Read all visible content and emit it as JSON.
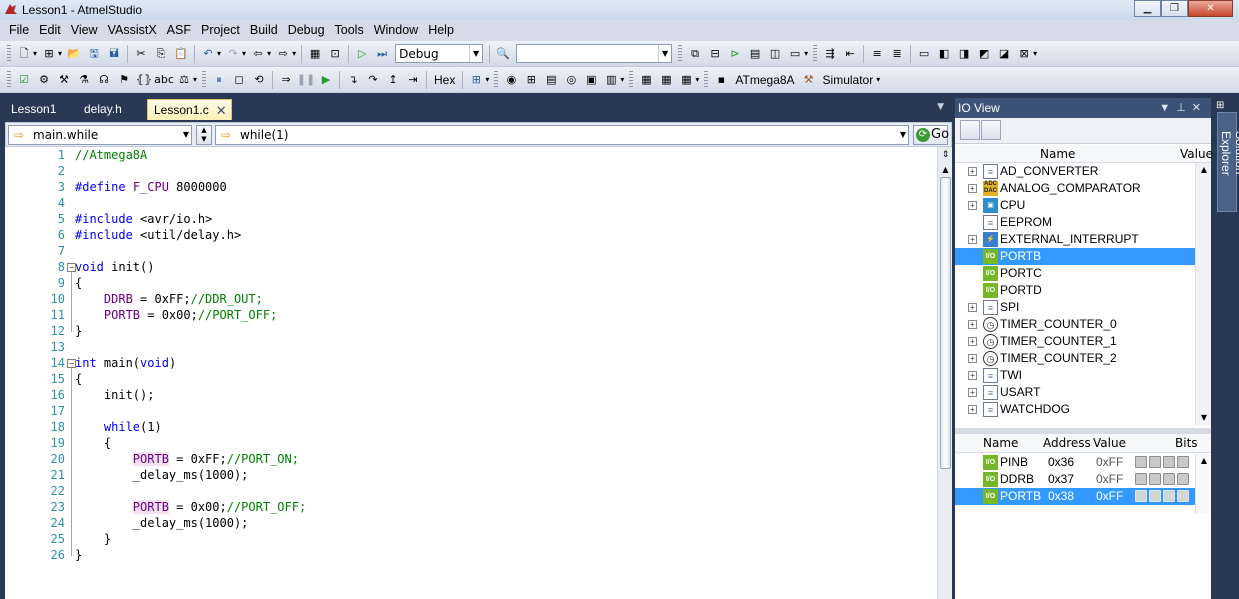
{
  "window": {
    "title": "Lesson1 - AtmelStudio",
    "buttons": [
      "0",
      "1",
      "r"
    ]
  },
  "menu": [
    "File",
    "Edit",
    "View",
    "VAssistX",
    "ASF",
    "Project",
    "Build",
    "Debug",
    "Tools",
    "Window",
    "Help"
  ],
  "toolbar": {
    "config_value": "Debug",
    "find_value": "",
    "hex_label": "Hex",
    "device_label": "ATmega8A",
    "tool_label": "Simulator"
  },
  "tabs": [
    {
      "label": "Lesson1",
      "active": false
    },
    {
      "label": "delay.h",
      "active": false
    },
    {
      "label": "Lesson1.c",
      "active": true
    }
  ],
  "navbar": {
    "scope": "main.while",
    "member": "while(1)",
    "go_label": "Go"
  },
  "code": [
    {
      "n": "1",
      "html": "<span class=\"cm\">//Atmega8A</span>"
    },
    {
      "n": "2",
      "html": ""
    },
    {
      "n": "3",
      "html": "<span class=\"pp\">#define</span> <span class=\"mac\">F_CPU</span> 8000000"
    },
    {
      "n": "4",
      "html": ""
    },
    {
      "n": "5",
      "html": "<span class=\"pp\">#include</span> &lt;avr/io.h&gt;"
    },
    {
      "n": "6",
      "html": "<span class=\"pp\">#include</span> &lt;util/delay.h&gt;"
    },
    {
      "n": "7",
      "html": ""
    },
    {
      "n": "8",
      "html": "<span class=\"kw\">void</span> init()",
      "fold": true
    },
    {
      "n": "9",
      "html": "{"
    },
    {
      "n": "10",
      "html": "    <span class=\"mac\">DDRB</span> = 0xFF;<span class=\"cm\">//DDR_OUT;</span>"
    },
    {
      "n": "11",
      "html": "    <span class=\"mac\">PORTB</span> = 0x00;<span class=\"cm\">//PORT_OFF;</span>"
    },
    {
      "n": "12",
      "html": "}"
    },
    {
      "n": "13",
      "html": ""
    },
    {
      "n": "14",
      "html": "<span class=\"kw\">int</span> main(<span class=\"kw\">void</span>)",
      "fold": true
    },
    {
      "n": "15",
      "html": "{"
    },
    {
      "n": "16",
      "html": "    init();"
    },
    {
      "n": "17",
      "html": ""
    },
    {
      "n": "18",
      "html": "    <span class=\"kw\">while</span>(1)"
    },
    {
      "n": "19",
      "html": "    {"
    },
    {
      "n": "20",
      "html": "        <span class=\"mac hl\">PORTB</span> = 0xFF;<span class=\"cm\">//PORT_ON;</span>"
    },
    {
      "n": "21",
      "html": "        _delay_ms(1000);"
    },
    {
      "n": "22",
      "html": ""
    },
    {
      "n": "23",
      "html": "        <span class=\"mac hl\">PORTB</span> = 0x00;<span class=\"cm\">//PORT_OFF;</span>"
    },
    {
      "n": "24",
      "html": "        _delay_ms(1000);"
    },
    {
      "n": "25",
      "html": "    }"
    },
    {
      "n": "26",
      "html": "}"
    }
  ],
  "io_view": {
    "title": "IO View",
    "tree_cols": {
      "name": "Name",
      "value": "Value"
    },
    "tree": [
      {
        "label": "AD_CONVERTER",
        "icon": "doc-icon",
        "expand": true
      },
      {
        "label": "ANALOG_COMPARATOR",
        "icon": "adc-icon",
        "expand": true
      },
      {
        "label": "CPU",
        "icon": "cpu-icon",
        "expand": true
      },
      {
        "label": "EEPROM",
        "icon": "doc-icon",
        "expand": false
      },
      {
        "label": "EXTERNAL_INTERRUPT",
        "icon": "interrupt-icon",
        "expand": true
      },
      {
        "label": "PORTB",
        "icon": "io-icon",
        "expand": false,
        "selected": true
      },
      {
        "label": "PORTC",
        "icon": "io-icon",
        "expand": false
      },
      {
        "label": "PORTD",
        "icon": "io-icon",
        "expand": false
      },
      {
        "label": "SPI",
        "icon": "doc-icon",
        "expand": true
      },
      {
        "label": "TIMER_COUNTER_0",
        "icon": "clock-icon",
        "expand": true
      },
      {
        "label": "TIMER_COUNTER_1",
        "icon": "clock-icon",
        "expand": true
      },
      {
        "label": "TIMER_COUNTER_2",
        "icon": "clock-icon",
        "expand": true
      },
      {
        "label": "TWI",
        "icon": "doc-icon",
        "expand": true
      },
      {
        "label": "USART",
        "icon": "doc-icon",
        "expand": true
      },
      {
        "label": "WATCHDOG",
        "icon": "doc-icon",
        "expand": true
      }
    ],
    "reg_cols": {
      "name": "Name",
      "address": "Address",
      "value": "Value",
      "bits": "Bits"
    },
    "registers": [
      {
        "name": "PINB",
        "address": "0x36",
        "value": "0xFF"
      },
      {
        "name": "DDRB",
        "address": "0x37",
        "value": "0xFF"
      },
      {
        "name": "PORTB",
        "address": "0x38",
        "value": "0xFF",
        "selected": true
      }
    ]
  },
  "side_tab": "Solution Explorer"
}
